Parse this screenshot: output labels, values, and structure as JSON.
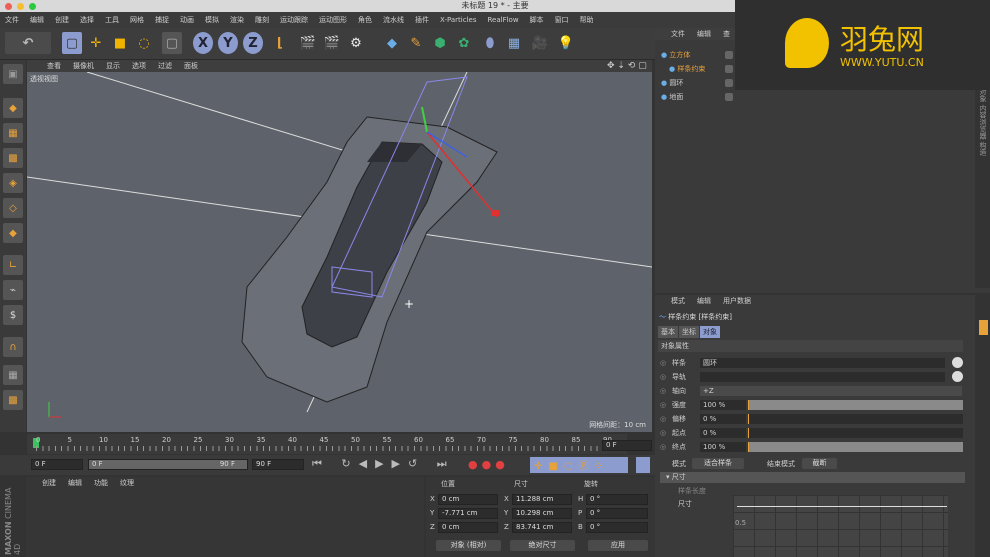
{
  "window": {
    "title": "未标题 19 * - 主要"
  },
  "menu": [
    "文件",
    "编辑",
    "创建",
    "选择",
    "工具",
    "网格",
    "捕捉",
    "动画",
    "模拟",
    "渲染",
    "雕刻",
    "运动跟踪",
    "运动图形",
    "角色",
    "流水线",
    "插件",
    "X-Particles",
    "RealFlow",
    "脚本",
    "窗口",
    "帮助"
  ],
  "toolbar": {
    "icons": [
      "undo-icon",
      "live-select-icon",
      "move-icon",
      "scale-icon",
      "rotate-icon",
      "recent-tools-icon",
      "x-axis-icon",
      "y-axis-icon",
      "z-axis-icon",
      "coordinate-system-icon",
      "render-view-icon",
      "render-picture-queue-icon",
      "render-settings-icon",
      "cube-icon",
      "pen-spline-icon",
      "subdivision-icon",
      "cloner-icon",
      "deformer-icon",
      "floor-icon",
      "camera-icon",
      "light-icon"
    ],
    "axes": [
      "X",
      "Y",
      "Z"
    ]
  },
  "viewport": {
    "menu": [
      "查看",
      "摄像机",
      "显示",
      "选项",
      "过滤",
      "面板"
    ],
    "label": "透视视图",
    "grid_info": "网格间距：10 cm"
  },
  "watermark": {
    "brand": "羽兔网",
    "url": "WWW.YUTU.CN"
  },
  "object_manager": {
    "menu": [
      "文件",
      "编辑",
      "查"
    ],
    "objects": [
      {
        "name": "立方体",
        "active": true
      },
      {
        "name": "样条约束",
        "active": true
      },
      {
        "name": "圆环",
        "active": false
      },
      {
        "name": "地面",
        "active": false
      }
    ],
    "side_tabs": [
      "对象",
      "内容浏览器",
      "构造"
    ]
  },
  "attributes": {
    "menu": [
      "模式",
      "编辑",
      "用户数据"
    ],
    "object_title": "样条约束 [样条约束]",
    "tabs": [
      "基本",
      "坐标",
      "对象"
    ],
    "active_tab": "对象",
    "section": "对象属性",
    "fields": [
      {
        "label": "样条",
        "value": "圆环"
      },
      {
        "label": "导轨",
        "value": ""
      },
      {
        "label": "轴向",
        "value": "+Z"
      },
      {
        "label": "强度",
        "value": "100 %",
        "fill": 1.0
      },
      {
        "label": "偏移",
        "value": "0 %",
        "fill": 0
      },
      {
        "label": "起点",
        "value": "0 %",
        "fill": 0
      },
      {
        "label": "终点",
        "value": "100 %",
        "fill": 1.0
      }
    ],
    "mode_label": "模式",
    "mode_value": "适合样条",
    "end_mode_label": "结束模式",
    "end_mode_value": "截断",
    "size_section": "尺寸",
    "size_relative": "样条长度",
    "size_label": "尺寸",
    "curve_tick": "0.5"
  },
  "timeline": {
    "ticks": [
      "0",
      "5",
      "10",
      "15",
      "20",
      "25",
      "30",
      "35",
      "40",
      "45",
      "50",
      "55",
      "60",
      "65",
      "70",
      "75",
      "80",
      "85",
      "90"
    ],
    "current": "0 F",
    "start": "0 F",
    "range_start": "0 F",
    "range_end": "90 F",
    "end": "90 F"
  },
  "materials": {
    "menu": [
      "创建",
      "编辑",
      "功能",
      "纹理"
    ]
  },
  "coordinates": {
    "headers": [
      "位置",
      "尺寸",
      "旋转"
    ],
    "rows": [
      {
        "axis": "X",
        "pos": "0 cm",
        "saxis": "X",
        "size": "11.288 cm",
        "raxis": "H",
        "rot": "0 °"
      },
      {
        "axis": "Y",
        "pos": "-7.771 cm",
        "saxis": "Y",
        "size": "10.298 cm",
        "raxis": "P",
        "rot": "0 °"
      },
      {
        "axis": "Z",
        "pos": "0 cm",
        "saxis": "Z",
        "size": "83.741 cm",
        "raxis": "B",
        "rot": "0 °"
      }
    ],
    "mode": "对象 (相对)",
    "size_mode": "绝对尺寸",
    "apply": "应用"
  },
  "logo": {
    "brand": "MAXON",
    "product": "CINEMA 4D"
  },
  "colors": {
    "accent": "#e8a23a",
    "selection": "#8c9ccf",
    "watermark": "#f2c200",
    "viewport_bg": "#5e636b"
  }
}
